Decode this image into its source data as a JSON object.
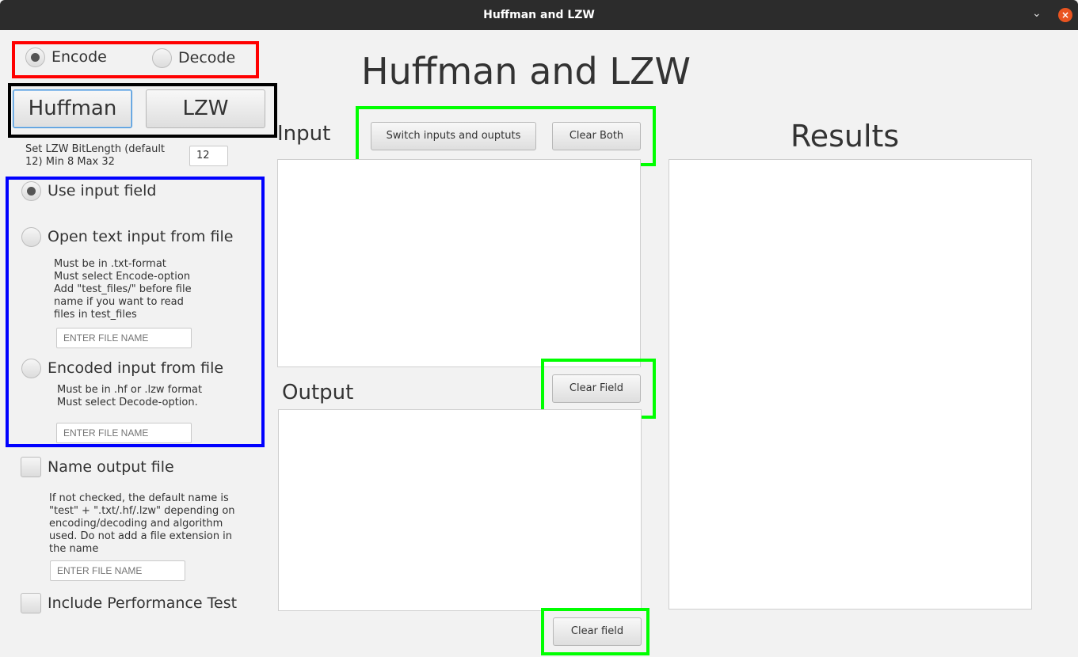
{
  "window": {
    "title": "Huffman and LZW",
    "minimize_icon": "chevron-down-icon",
    "close_icon": "close-icon",
    "close_color": "#e95420"
  },
  "mode": {
    "encode_label": "Encode",
    "decode_label": "Decode",
    "selected": "Encode"
  },
  "algorithm": {
    "huffman_label": "Huffman",
    "lzw_label": "LZW"
  },
  "lzw_bitlength": {
    "label": "Set LZW BitLength (default\n12) Min 8 Max 32",
    "value": "12"
  },
  "input_source": {
    "use_field_label": "Use input field",
    "open_file_label": "Open text input from file",
    "open_file_help": "Must be in .txt-format\nMust select Encode-option\nAdd \"test_files/\" before file\nname if you want to read\nfiles in test_files",
    "open_file_placeholder": "ENTER FILE NAME",
    "encoded_file_label": "Encoded input from file",
    "encoded_file_help": "Must be in .hf or .lzw format\nMust select Decode-option.",
    "encoded_file_placeholder": "ENTER FILE NAME",
    "selected": "Use input field"
  },
  "output_name": {
    "label": "Name output file",
    "help": "If not checked, the default name is\n\"test\" + \".txt/.hf/.lzw\" depending on\nencoding/decoding and algorithm\nused. Do not add a file extension in\nthe name",
    "placeholder": "ENTER FILE NAME",
    "checked": false
  },
  "performance": {
    "label": "Include Performance Test",
    "checked": false
  },
  "main": {
    "title": "Huffman and LZW",
    "input_heading": "Input",
    "output_heading": "Output",
    "results_heading": "Results",
    "switch_button": "Switch inputs and ouptuts",
    "clear_both_button": "Clear Both",
    "clear_input_button": "Clear Field",
    "clear_output_button": "Clear field"
  },
  "annotation_colors": {
    "mode_box": "#ff0000",
    "algorithm_box": "#000000",
    "input_source_box": "#0000ff",
    "action_boxes": "#00ff00"
  }
}
